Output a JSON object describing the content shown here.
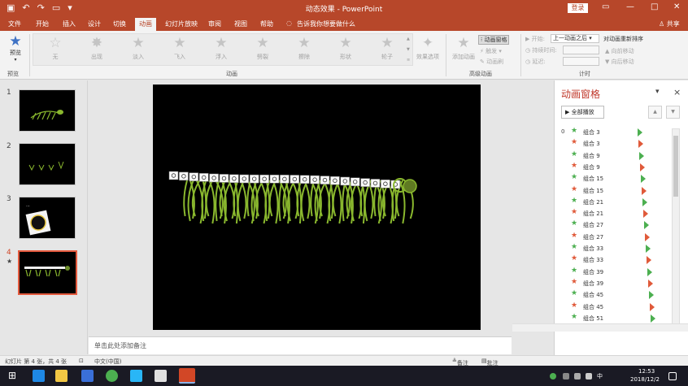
{
  "window": {
    "title": "动态效果 - PowerPoint",
    "login_label": "登录",
    "share_label": "共享",
    "controls": [
      "—",
      "□",
      "✕"
    ]
  },
  "ribbon_tabs": [
    "文件",
    "开始",
    "插入",
    "设计",
    "切换",
    "动画",
    "幻灯片放映",
    "审阅",
    "视图",
    "帮助"
  ],
  "active_tab": "动画",
  "tell_me": "告诉我你想要做什么",
  "ribbon": {
    "preview_label": "预览",
    "preview_group": "预览",
    "effects": [
      "无",
      "出现",
      "淡入",
      "飞入",
      "浮入",
      "劈裂",
      "擦除",
      "形状",
      "轮子"
    ],
    "effect_options_label": "效果选项",
    "animation_group": "动画",
    "add_animation_label": "添加动画",
    "anim_pane_label": "动画窗格",
    "trigger_label": "触发",
    "anim_painter_label": "动画刷",
    "advanced_group": "高级动画",
    "start_label": "开始:",
    "start_value": "上一动画之后",
    "duration_label": "持续时间:",
    "delay_label": "延迟:",
    "reorder_label": "对动画重新排序",
    "move_earlier": "向前移动",
    "move_later": "向后移动",
    "timing_group": "计时"
  },
  "slides": [
    {
      "num": "1",
      "star": ""
    },
    {
      "num": "2",
      "star": ""
    },
    {
      "num": "3",
      "star": ""
    },
    {
      "num": "4",
      "star": "★"
    }
  ],
  "notes_placeholder": "单击此处添加备注",
  "anim_pane": {
    "title": "动画窗格",
    "play_all_label": "全部播放",
    "items": [
      {
        "num": "0",
        "star_color": "#4caf50",
        "name": "组合 3",
        "tri_color": "#4caf50"
      },
      {
        "num": "",
        "star_color": "#e05a3a",
        "name": "组合 3",
        "tri_color": "#e05a3a"
      },
      {
        "num": "",
        "star_color": "#4caf50",
        "name": "组合 9",
        "tri_color": "#4caf50"
      },
      {
        "num": "",
        "star_color": "#e05a3a",
        "name": "组合 9",
        "tri_color": "#e05a3a"
      },
      {
        "num": "",
        "star_color": "#4caf50",
        "name": "组合 15",
        "tri_color": "#4caf50"
      },
      {
        "num": "",
        "star_color": "#e05a3a",
        "name": "组合 15",
        "tri_color": "#e05a3a"
      },
      {
        "num": "",
        "star_color": "#4caf50",
        "name": "组合 21",
        "tri_color": "#4caf50"
      },
      {
        "num": "",
        "star_color": "#e05a3a",
        "name": "组合 21",
        "tri_color": "#e05a3a"
      },
      {
        "num": "",
        "star_color": "#4caf50",
        "name": "组合 27",
        "tri_color": "#4caf50"
      },
      {
        "num": "",
        "star_color": "#e05a3a",
        "name": "组合 27",
        "tri_color": "#e05a3a"
      },
      {
        "num": "",
        "star_color": "#4caf50",
        "name": "组合 33",
        "tri_color": "#4caf50"
      },
      {
        "num": "",
        "star_color": "#e05a3a",
        "name": "组合 33",
        "tri_color": "#e05a3a"
      },
      {
        "num": "",
        "star_color": "#4caf50",
        "name": "组合 39",
        "tri_color": "#4caf50"
      },
      {
        "num": "",
        "star_color": "#e05a3a",
        "name": "组合 39",
        "tri_color": "#e05a3a"
      },
      {
        "num": "",
        "star_color": "#4caf50",
        "name": "组合 45",
        "tri_color": "#4caf50"
      },
      {
        "num": "",
        "star_color": "#e05a3a",
        "name": "组合 45",
        "tri_color": "#e05a3a"
      },
      {
        "num": "",
        "star_color": "#4caf50",
        "name": "组合 51",
        "tri_color": "#4caf50"
      }
    ]
  },
  "status": {
    "slide_info": "幻灯片 第 4 张，共 4 张",
    "language": "中文(中国)",
    "notes_label": "备注",
    "comments_label": "批注"
  },
  "taskbar": {
    "time": "12:53",
    "date": "2018/12/2",
    "ime": "中"
  },
  "colors": {
    "accent": "#b7472a",
    "pane_title": "#c0392b",
    "caterpillar": "#8ab82e"
  }
}
